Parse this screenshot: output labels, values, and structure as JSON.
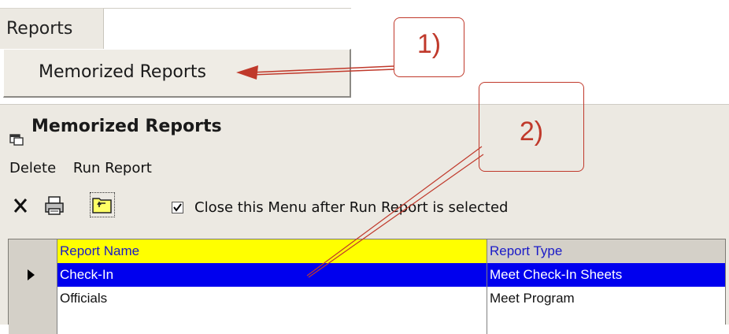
{
  "top_menu": {
    "reports_label": "Reports",
    "memorized_reports_label": "Memorized Reports"
  },
  "window": {
    "title": "Memorized Reports",
    "menu": {
      "delete_label": "Delete",
      "run_report_label": "Run Report"
    },
    "toolbar": {
      "delete_icon": "close-icon",
      "print_icon": "printer-icon",
      "folder_icon": "folder-up-icon",
      "close_menu_checkbox_label": "Close this Menu after Run Report is selected",
      "close_menu_checked": true
    },
    "grid": {
      "columns": [
        "Report Name",
        "Report Type"
      ],
      "rows": [
        {
          "name": "Check-In",
          "type": "Meet Check-In Sheets",
          "selected": true
        },
        {
          "name": "Officials",
          "type": "Meet Program",
          "selected": false
        }
      ]
    }
  },
  "annotations": {
    "callout_1": "1)",
    "callout_2": "2)",
    "color": "#c0392b"
  },
  "colors": {
    "header_highlight": "#ffff00",
    "selection": "#0000ee",
    "window_bg": "#ece9e2"
  }
}
